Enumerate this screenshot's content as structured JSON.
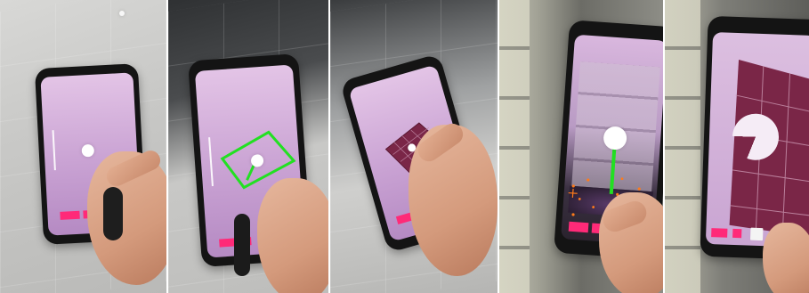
{
  "image": {
    "panels": [
      {
        "name": "panel-1"
      },
      {
        "name": "panel-2"
      },
      {
        "name": "panel-3"
      },
      {
        "name": "panel-4"
      },
      {
        "name": "panel-5"
      }
    ]
  },
  "colors": {
    "ui_pink": "#ff2a78",
    "outline_green": "#22e022",
    "wall_maroon": "#7a2647",
    "orange_points": "#ff7a1a",
    "screen_lilac": "#d7b3dd"
  }
}
